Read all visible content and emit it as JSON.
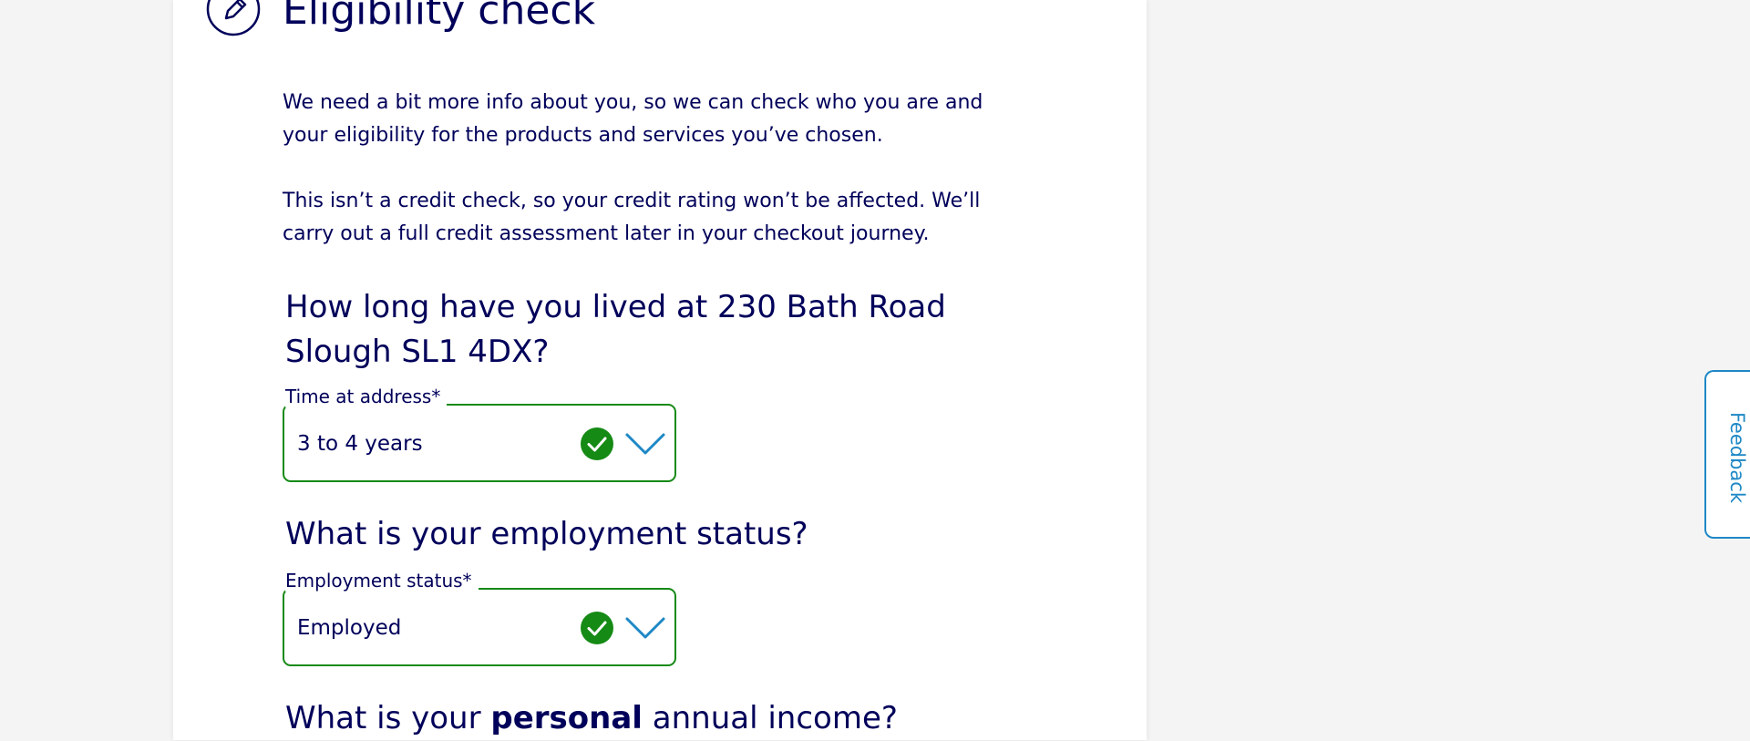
{
  "page": {
    "title": "Eligibility check",
    "intro_paragraphs": [
      "We need a bit more info about you, so we can check who you are and your eligibility for the products and services you’ve chosen.",
      "This isn’t a credit check, so your credit rating won’t be affected. We’ll carry out a full credit assessment later in your checkout journey."
    ]
  },
  "questions": {
    "address": "How long have you lived at 230 Bath Road Slough SL1 4DX?",
    "employment": "What is your employment status?",
    "income": {
      "before": "What is your ",
      "emphasis": "personal",
      "after": " annual income?"
    }
  },
  "fields": {
    "time_at_address": {
      "label": "Time at address*",
      "value": "3 to 4 years",
      "status": "valid"
    },
    "employment_status": {
      "label": "Employment status*",
      "value": "Employed",
      "status": "valid"
    }
  },
  "feedback": {
    "label": "Feedback"
  },
  "colors": {
    "text": "#00005a",
    "valid": "#158a15",
    "accent": "#1e88c6",
    "background": "#f4f4f4",
    "card": "#ffffff"
  },
  "icons": {
    "title": "pencil-edit-icon",
    "valid": "checkmark-circle-icon",
    "dropdown": "chevron-down-icon"
  }
}
